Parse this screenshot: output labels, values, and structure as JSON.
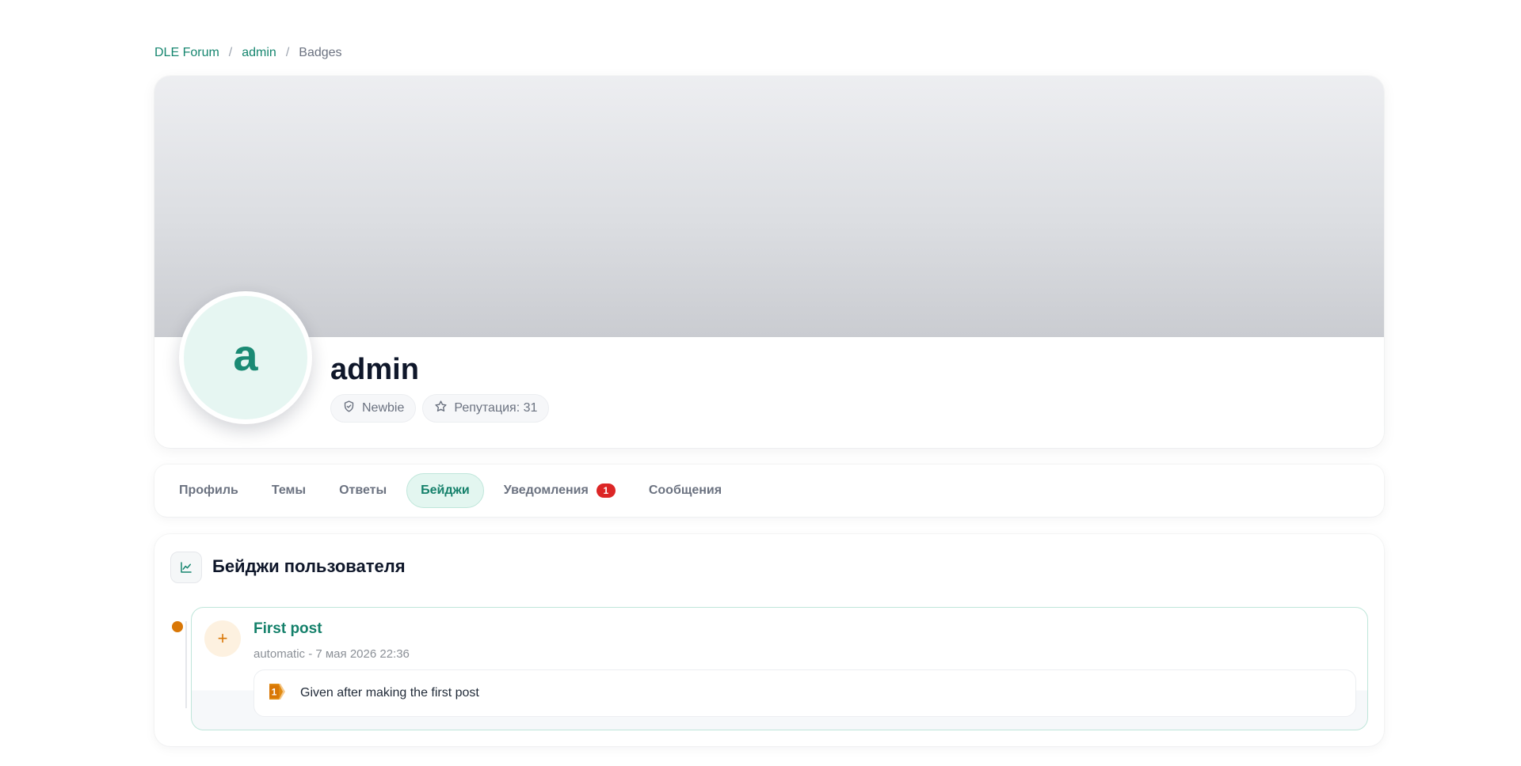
{
  "breadcrumb": {
    "items": [
      {
        "label": "DLE Forum"
      },
      {
        "label": "admin"
      }
    ],
    "current": "Badges",
    "separator": "/"
  },
  "profile": {
    "avatar_letter": "a",
    "username": "admin",
    "rank": "Newbie",
    "reputation": "Репутация: 31"
  },
  "tabs": [
    {
      "label": "Профиль"
    },
    {
      "label": "Темы"
    },
    {
      "label": "Ответы"
    },
    {
      "label": "Бейджи",
      "active": true
    },
    {
      "label": "Уведомления",
      "count": "1"
    },
    {
      "label": "Сообщения"
    }
  ],
  "badges_section": {
    "title": "Бейджи пользователя",
    "items": [
      {
        "name": "First post",
        "meta": "automatic - 7 мая 2026 22:36",
        "description": "Given after making the first post",
        "icon_text": "1"
      }
    ]
  },
  "colors": {
    "accent": "#16866f",
    "accent_soft": "#e3f6f0",
    "badge_orange": "#d97706",
    "notification_red": "#dc2626"
  },
  "icons": {
    "rank": "shield-check-icon",
    "reputation": "star-icon",
    "section": "chart-line-icon",
    "badge_action": "plus-icon",
    "badge": "numbered-badge-icon"
  }
}
